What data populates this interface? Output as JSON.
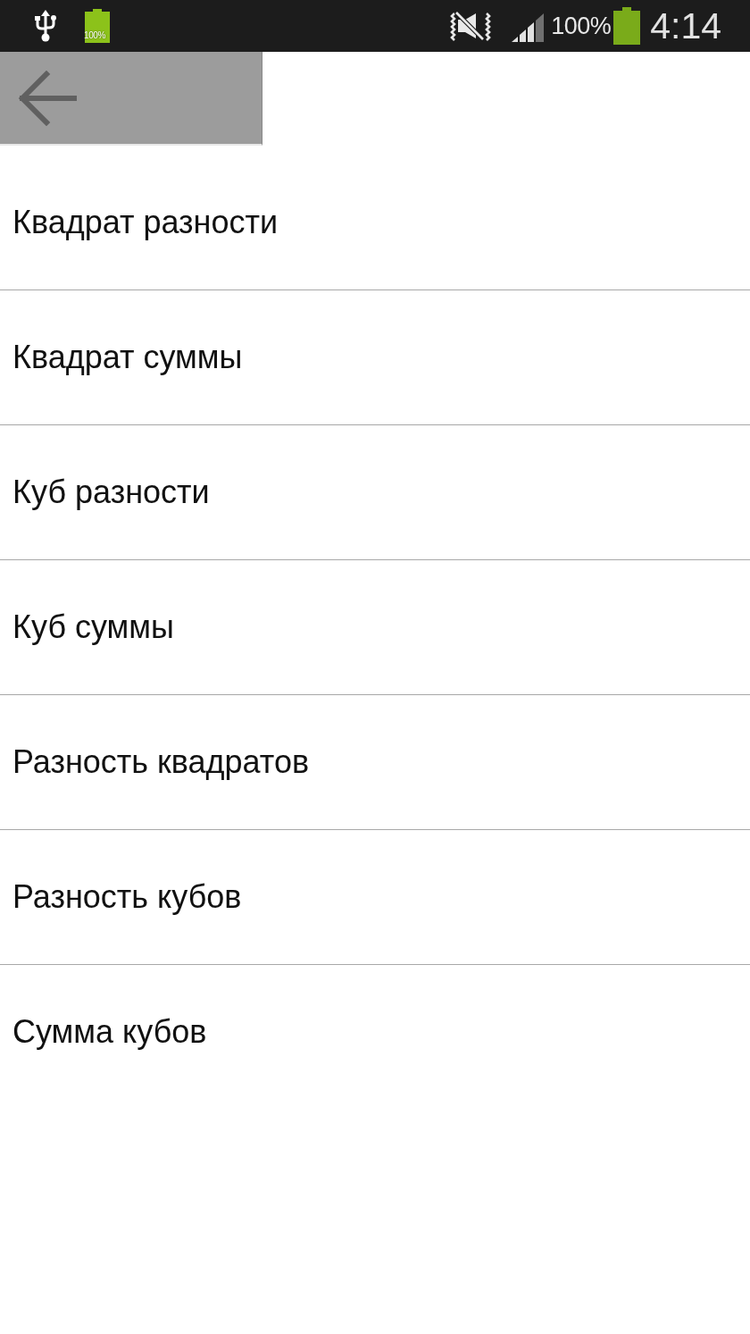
{
  "status_bar": {
    "charging_battery_label": "100%",
    "battery_percent": "100%",
    "time": "4:14"
  },
  "items": [
    {
      "label": "Квадрат разности"
    },
    {
      "label": "Квадрат суммы"
    },
    {
      "label": "Куб разности"
    },
    {
      "label": "Куб суммы"
    },
    {
      "label": "Разность квадратов"
    },
    {
      "label": "Разность кубов"
    },
    {
      "label": "Сумма кубов"
    }
  ]
}
